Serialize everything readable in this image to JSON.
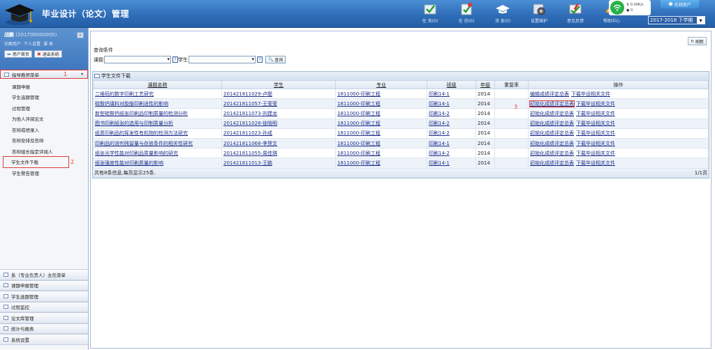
{
  "header": {
    "title": "毕业设计（论文）管理",
    "toolbar": [
      {
        "label": "任 务(0)",
        "icon": "tasks-icon"
      },
      {
        "label": "在 办(0)",
        "icon": "in-progress-icon"
      },
      {
        "label": "消 息(0)",
        "icon": "messages-icon"
      },
      {
        "label": "设置维护",
        "icon": "settings-icon"
      },
      {
        "label": "意见反馈",
        "icon": "feedback-icon"
      },
      {
        "label": "帮助中心",
        "icon": "help-icon"
      }
    ],
    "net_speed_up": "0.00K/s",
    "net_speed_down": "0",
    "online_users": "在线用户",
    "term": "2017-2018 下学期"
  },
  "sidebar": {
    "user_name": "战鹏",
    "user_id": "(201700000005)",
    "user_links": [
      "切换用户",
      "个人设置",
      "课 表"
    ],
    "home_btn": "用户首页",
    "logout_btn": "退出系统",
    "active_menu": "指导教师菜单",
    "marker_1": "1",
    "marker_2": "2",
    "items": [
      "课题申报",
      "学生选题管理",
      "过程管理",
      "为他人评阅论文",
      "答辩成绩录入",
      "答辩安排及答辩",
      "答辩组长指定评阅人",
      "学生文件下载",
      "学生警告管理"
    ],
    "bottom_menus": [
      "系（专业负责人）主任菜单",
      "课题申报管理",
      "学生选题管理",
      "过程监控",
      "论文库管理",
      "统计与报表",
      "系统设置"
    ]
  },
  "main": {
    "refresh": "刷新",
    "query_title": "查询条件",
    "query_topic_label": "课题",
    "query_student_label": "学生",
    "query_btn": "查询",
    "list_title": "学生文件下载",
    "columns": [
      "课题名称",
      "学生",
      "专业",
      "班级",
      "年级",
      "重复率",
      "操作"
    ],
    "rows": [
      {
        "topic": "二维码的数字印刷工艺研究",
        "student": "201421811029-卢聪",
        "major": "1811000-印刷工程",
        "class": "印刷14-1",
        "grade": "2014",
        "dup": "",
        "op1": "编辑成绩评定总表",
        "op2": "下载毕设相关文件"
      },
      {
        "topic": "硅酸钙填料对胶版印刷适性的影响",
        "student": "201421811057-王莹莹",
        "major": "1811000-印刷工程",
        "class": "印刷14-1",
        "grade": "2014",
        "dup": "",
        "op1": "初始化成绩评定总表",
        "op2": "下载毕设相关文件"
      },
      {
        "topic": "新型硅酸钙纸张印刷品印制质量的检测分析",
        "student": "201421811073-刘建龙",
        "major": "1811000-印刷工程",
        "class": "印刷14-2",
        "grade": "2014",
        "dup": "",
        "op1": "初始化成绩评定总表",
        "op2": "下载毕设相关文件"
      },
      {
        "topic": "图书印刷纸张的选用与印制质量分析",
        "student": "201421811028-徐晓明",
        "major": "1811000-印刷工程",
        "class": "印刷14-2",
        "grade": "2014",
        "dup": "",
        "op1": "初始化成绩评定总表",
        "op2": "下载毕设相关文件"
      },
      {
        "topic": "纸质印刷品的挥发性有机物的检测方法研究",
        "student": "201421811023-孙成",
        "major": "1811000-印刷工程",
        "class": "印刷14-2",
        "grade": "2014",
        "dup": "",
        "op1": "初始化成绩评定总表",
        "op2": "下载毕设相关文件"
      },
      {
        "topic": "印刷品的溶剂残留量与存放条件的相关性研究",
        "student": "201421811068-李贺文",
        "major": "1811000-印刷工程",
        "class": "印刷14-1",
        "grade": "2014",
        "dup": "",
        "op1": "初始化成绩评定总表",
        "op2": "下载毕设相关文件"
      },
      {
        "topic": "纸张光学性能对印刷品质量影响的研究",
        "student": "201421811055-周佳琪",
        "major": "1811000-印刷工程",
        "class": "印刷14-2",
        "grade": "2014",
        "dup": "",
        "op1": "初始化成绩评定总表",
        "op2": "下载毕设相关文件"
      },
      {
        "topic": "纸张强度性能对印刷质量的影响",
        "student": "201421811013-王鹏",
        "major": "1811000-印刷工程",
        "class": "印刷14-1",
        "grade": "2014",
        "dup": "",
        "op1": "初始化成绩评定总表",
        "op2": "下载毕设相关文件"
      }
    ],
    "marker_3": "3",
    "footer_info": "共有8条信息,每页显示25条.",
    "pages": "1/1页"
  }
}
